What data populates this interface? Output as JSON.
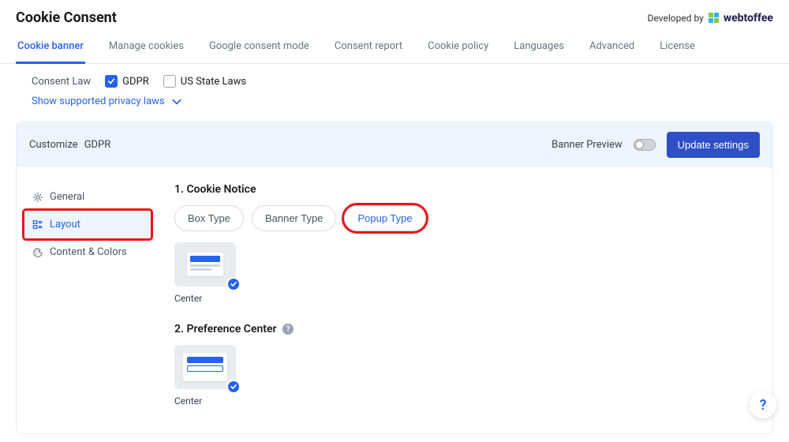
{
  "header": {
    "title": "Cookie Consent",
    "developed_by": "Developed by",
    "brand": "webtoffee"
  },
  "tabs": [
    {
      "label": "Cookie banner",
      "active": true
    },
    {
      "label": "Manage cookies",
      "active": false
    },
    {
      "label": "Google consent mode",
      "active": false
    },
    {
      "label": "Consent report",
      "active": false
    },
    {
      "label": "Cookie policy",
      "active": false
    },
    {
      "label": "Languages",
      "active": false
    },
    {
      "label": "Advanced",
      "active": false
    },
    {
      "label": "License",
      "active": false
    }
  ],
  "consent_law": {
    "label": "Consent Law",
    "options": [
      {
        "label": "GDPR",
        "checked": true
      },
      {
        "label": "US State Laws",
        "checked": false
      }
    ],
    "supported_link": "Show supported privacy laws"
  },
  "panel": {
    "customize_label": "Customize",
    "target": "GDPR",
    "preview_label": "Banner Preview",
    "update_btn": "Update settings"
  },
  "side_nav": [
    {
      "label": "General",
      "icon": "gear",
      "active": false
    },
    {
      "label": "Layout",
      "icon": "layout",
      "active": true,
      "highlight": true
    },
    {
      "label": "Content & Colors",
      "icon": "palette",
      "active": false
    }
  ],
  "sections": {
    "cookie_notice": {
      "title": "1. Cookie Notice",
      "types": [
        {
          "label": "Box Type",
          "selected": false
        },
        {
          "label": "Banner Type",
          "selected": false
        },
        {
          "label": "Popup Type",
          "selected": true,
          "highlight": true
        }
      ],
      "option_caption": "Center"
    },
    "preference_center": {
      "title": "2. Preference Center",
      "option_caption": "Center"
    }
  },
  "help": "?"
}
